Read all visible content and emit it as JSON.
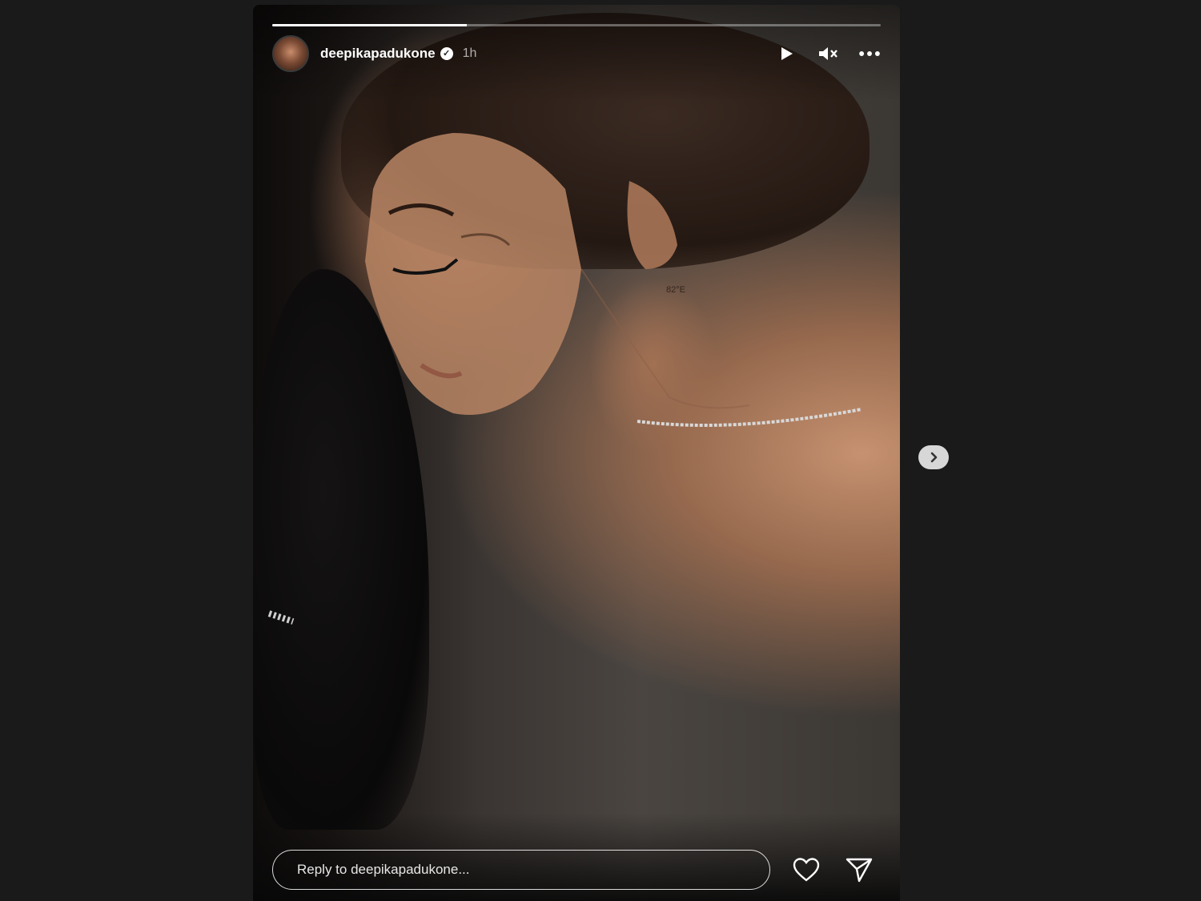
{
  "story": {
    "progress": [
      {
        "fraction": 0.32
      }
    ],
    "header": {
      "username": "deepikapadukone",
      "verified": true,
      "time": "1h",
      "avatar_icon": "profile-avatar"
    },
    "controls": {
      "play_icon": "play-icon",
      "mute_icon": "volume-muted-icon",
      "more_icon": "more-options-icon"
    },
    "media": {
      "tattoo_text": "82°E"
    },
    "reply": {
      "placeholder": "Reply to deepikapadukone...",
      "like_icon": "heart-icon",
      "share_icon": "send-icon"
    }
  },
  "navigation": {
    "next_icon": "chevron-right-icon"
  },
  "colors": {
    "background": "#1a1a1a",
    "text": "#ffffff",
    "next_button": "#d7d7d7"
  }
}
